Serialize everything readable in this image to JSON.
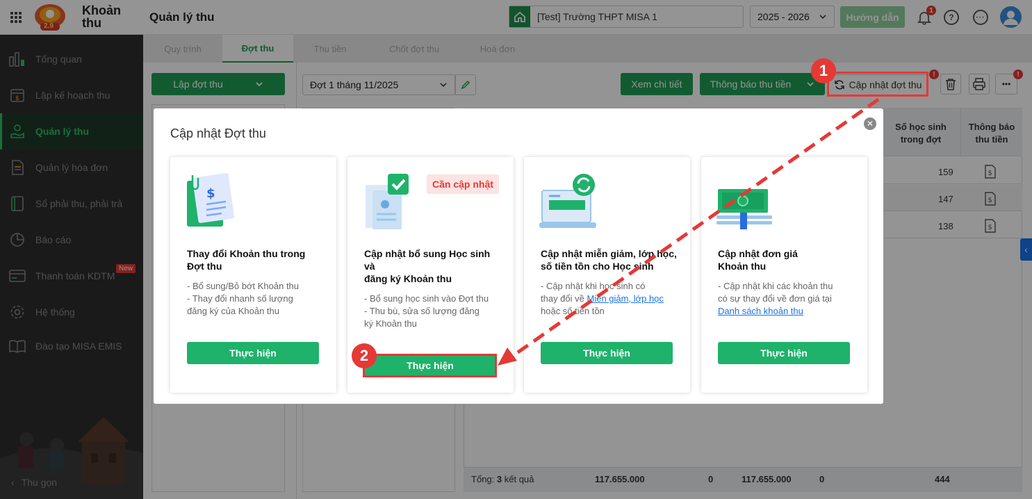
{
  "app": {
    "name_line1": "Khoản",
    "name_line2": "thu",
    "page_title": "Quản lý thu",
    "logo_badge": "2.9"
  },
  "header": {
    "school": "[Test] Trường THPT MISA 1",
    "year": "2025 - 2026",
    "guide_label": "Hướng dẫn",
    "notification_count": "1",
    "help_glyph": "?"
  },
  "sidebar": {
    "items": [
      {
        "label": "Tổng quan",
        "icon": "bar-chart-icon"
      },
      {
        "label": "Lập kế hoạch thu",
        "icon": "calendar-money-icon"
      },
      {
        "label": "Quản lý thu",
        "icon": "hand-coin-icon"
      },
      {
        "label": "Quản lý hóa đơn",
        "icon": "invoice-icon"
      },
      {
        "label": "Sổ phải thu, phải trả",
        "icon": "ledger-book-icon"
      },
      {
        "label": "Báo cáo",
        "icon": "pie-chart-icon"
      },
      {
        "label": "Thanh toán KDTM",
        "icon": "card-payment-icon"
      },
      {
        "label": "Hệ thống",
        "icon": "gear-icon"
      },
      {
        "label": "Đào tạo MISA EMIS",
        "icon": "book-icon"
      }
    ],
    "new_badge": "New",
    "collapse_label": "Thu gọn"
  },
  "tabs": [
    "Quy trình",
    "Đợt thu",
    "Thu tiền",
    "Chốt đợt thu",
    "Hoá đơn"
  ],
  "toolbar": {
    "create_label": "Lập đợt thu",
    "period_value": "Đợt 1 tháng 11/2025",
    "view_detail": "Xem chi tiết",
    "notify": "Thông báo thu tiền",
    "update": "Cập nhật đợt thu",
    "alert_glyph": "!",
    "more_glyph": "•••"
  },
  "table": {
    "headers": [
      "Số học sinh trong đợt",
      "Thông báo thu tiền"
    ],
    "rows": [
      "159",
      "147",
      "138"
    ],
    "footer": {
      "label": "Tổng:",
      "count": "3",
      "suffix": "kết quả",
      "v1": "117.655.000",
      "v2": "0",
      "v3": "117.655.000",
      "v4": "0",
      "v5": "444"
    }
  },
  "modal": {
    "title": "Cập nhật Đợt thu",
    "close_glyph": "✕",
    "cards": [
      {
        "title_lines": [
          "Thay đổi Khoản thu trong",
          "Đợt thu"
        ],
        "desc": [
          "- Bổ sung/Bỏ bớt Khoản thu",
          "- Thay đổi nhanh số lượng",
          "đăng ký của Khoản thu"
        ],
        "button": "Thực hiện"
      },
      {
        "title_lines": [
          "Cập nhật bổ sung Học sinh",
          "và",
          "đăng ký Khoản thu"
        ],
        "desc": [
          "- Bổ sung học sinh vào Đợt thu",
          "- Thu bù, sửa số lượng đăng",
          "ký Khoản thu"
        ],
        "button": "Thực hiện",
        "badge": "Cần cập nhật"
      },
      {
        "title_lines": [
          "Cập nhật miễn giảm, lớp học,",
          "số tiền tồn cho Học sinh"
        ],
        "desc_line1": "- Cập nhật khi học sinh có",
        "desc_line2_prefix": "thay đổi về ",
        "desc_link": "Miễn giảm, lớp học",
        "desc_line3": "hoặc số tiền tồn",
        "button": "Thực hiện"
      },
      {
        "title_lines": [
          "Cập nhật đơn giá",
          "Khoản thu"
        ],
        "desc_line1": "- Cập nhật khi các khoản thu",
        "desc_line2": "có sự thay đổi về đơn giá tại",
        "desc_link": "Danh sách khoản thu",
        "button": "Thực hiện"
      }
    ]
  },
  "markers": [
    "1",
    "2"
  ],
  "colors": {
    "primary": "#1f9d55",
    "button": "#1fb26b",
    "alert": "#e53935",
    "sidebar_bg": "#2e2e2e"
  }
}
